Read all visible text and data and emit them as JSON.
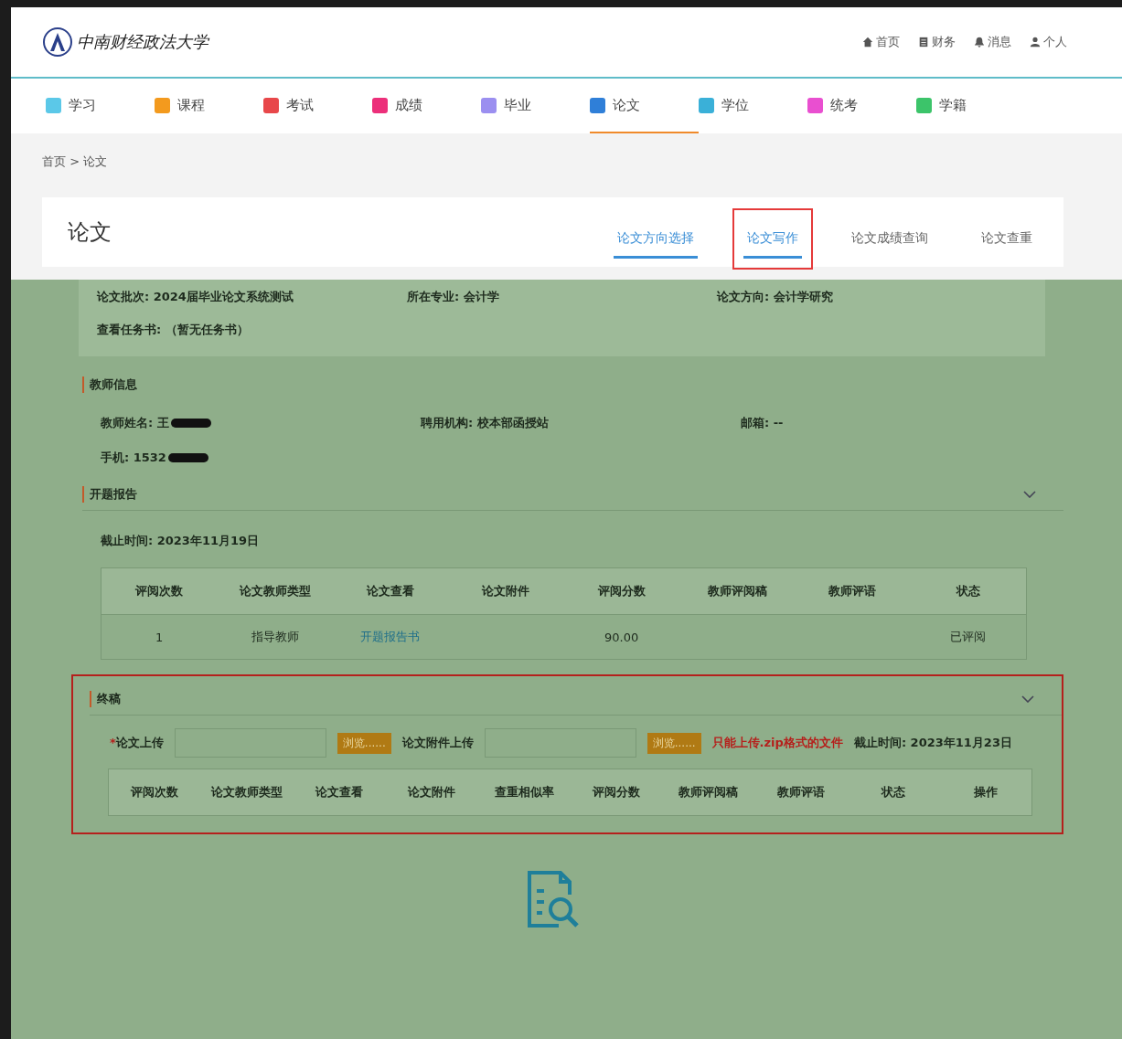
{
  "header": {
    "logo_text": "中南财经政法大学",
    "links": [
      {
        "label": "首页"
      },
      {
        "label": "财务"
      },
      {
        "label": "消息"
      },
      {
        "label": "个人"
      }
    ]
  },
  "nav": [
    {
      "label": "学习",
      "color": "#5bc8e8",
      "selected": false
    },
    {
      "label": "课程",
      "color": "#f39a1e",
      "selected": false
    },
    {
      "label": "考试",
      "color": "#e8474a",
      "selected": false
    },
    {
      "label": "成绩",
      "color": "#ec2f7a",
      "selected": false
    },
    {
      "label": "毕业",
      "color": "#9b8ff0",
      "selected": false
    },
    {
      "label": "论文",
      "color": "#2f7fd8",
      "selected": true
    },
    {
      "label": "学位",
      "color": "#3ab0d8",
      "selected": false
    },
    {
      "label": "统考",
      "color": "#e94fd0",
      "selected": false
    },
    {
      "label": "学籍",
      "color": "#3cc46a",
      "selected": false
    }
  ],
  "breadcrumb": "首页 > 论文",
  "page_title": "论文",
  "tabs": [
    {
      "label": "论文方向选择",
      "selected": false,
      "underlined": true
    },
    {
      "label": "论文写作",
      "selected": true,
      "underlined": true
    },
    {
      "label": "论文成绩查询",
      "selected": false,
      "underlined": false
    },
    {
      "label": "论文查重",
      "selected": false,
      "underlined": false
    }
  ],
  "info": [
    {
      "label": "论文批次:",
      "value": "2024届毕业论文系统测试"
    },
    {
      "label": "所在专业:",
      "value": "会计学"
    },
    {
      "label": "论文方向:",
      "value": "会计学研究"
    }
  ],
  "task_book": {
    "label": "查看任务书:",
    "value": "（暂无任务书）"
  },
  "teacher": {
    "title": "教师信息",
    "fields": [
      {
        "label": "教师姓名:",
        "value": "王",
        "redacted": true
      },
      {
        "label": "聘用机构:",
        "value": "校本部函授站",
        "redacted": false
      },
      {
        "label": "邮箱:",
        "value": "--",
        "redacted": false
      },
      {
        "label": "手机:",
        "value": "1532",
        "redacted": true
      }
    ]
  },
  "proposal": {
    "title": "开题报告",
    "deadline_label": "截止时间:",
    "deadline": "2023年11月19日",
    "columns": [
      "评阅次数",
      "论文教师类型",
      "论文查看",
      "论文附件",
      "评阅分数",
      "教师评阅稿",
      "教师评语",
      "状态"
    ],
    "rows": [
      [
        {
          "text": "1",
          "kind": "text"
        },
        {
          "text": "指导教师",
          "kind": "text"
        },
        {
          "text": "开题报告书",
          "kind": "link"
        },
        {
          "text": "",
          "kind": "text"
        },
        {
          "text": "90.00",
          "kind": "text"
        },
        {
          "text": "",
          "kind": "text"
        },
        {
          "text": "",
          "kind": "text"
        },
        {
          "text": "已评阅",
          "kind": "text"
        }
      ]
    ]
  },
  "final": {
    "title": "终稿",
    "highlighted": true,
    "upload": {
      "required_mark": "*",
      "label": "论文上传",
      "button": "浏览......"
    },
    "attachment": {
      "label": "论文附件上传",
      "button": "浏览......"
    },
    "note": "只能上传.zip格式的文件",
    "deadline_label": "截止时间:",
    "deadline": "2023年11月23日",
    "columns": [
      "评阅次数",
      "论文教师类型",
      "论文查看",
      "论文附件",
      "查重相似率",
      "评阅分数",
      "教师评阅稿",
      "教师评语",
      "状态",
      "操作"
    ]
  }
}
